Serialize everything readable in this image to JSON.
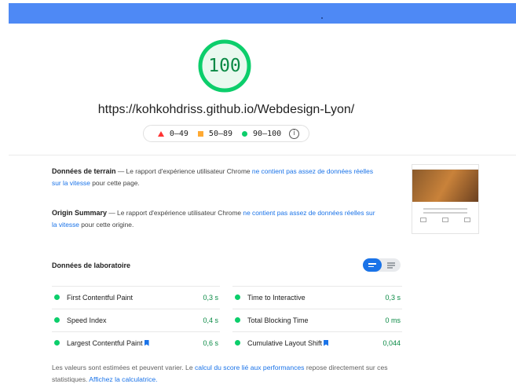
{
  "score": {
    "value": "100",
    "color": "#0cce6b"
  },
  "url": "https://kohkohdriss.github.io/Webdesign-Lyon/",
  "legend": {
    "fail": "0–49",
    "average": "50–89",
    "pass": "90–100"
  },
  "field_data": {
    "title": "Données de terrain",
    "text_before": " — Le rapport d'expérience utilisateur Chrome ",
    "link": "ne contient pas assez de données réelles sur la vitesse",
    "text_after": " pour cette page."
  },
  "origin_summary": {
    "title": "Origin Summary",
    "text_before": " — Le rapport d'expérience utilisateur Chrome ",
    "link": "ne contient pas assez de données réelles sur la vitesse",
    "text_after": " pour cette origine."
  },
  "lab": {
    "title": "Données de laboratoire"
  },
  "metrics": [
    {
      "label": "First Contentful Paint",
      "value": "0,3 s"
    },
    {
      "label": "Time to Interactive",
      "value": "0,3 s"
    },
    {
      "label": "Speed Index",
      "value": "0,4 s"
    },
    {
      "label": "Total Blocking Time",
      "value": "0 ms"
    },
    {
      "label": "Largest Contentful Paint",
      "value": "0,6 s"
    },
    {
      "label": "Cumulative Layout Shift",
      "value": "0,044"
    }
  ],
  "footer": {
    "text1": "Les valeurs sont estimées et peuvent varier. Le ",
    "link1": "calcul du score lié aux performances",
    "text2": " repose directement sur ces statistiques. ",
    "link2": "Affichez la calculatrice."
  }
}
